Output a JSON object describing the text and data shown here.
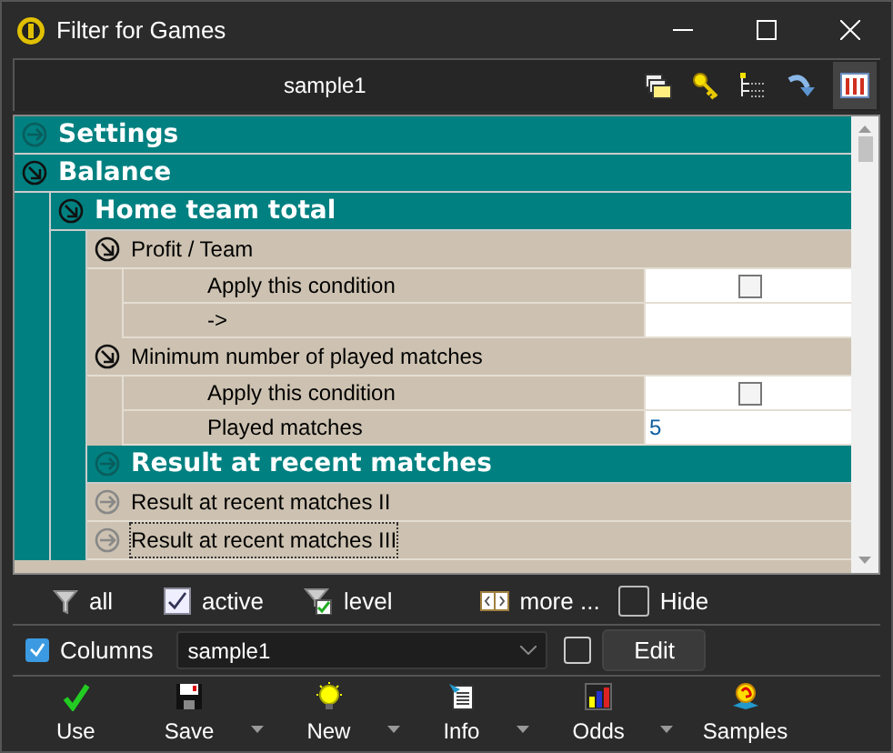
{
  "window": {
    "title": "Filter for Games"
  },
  "toolbar": {
    "filter_name": "sample1"
  },
  "tree": [
    {
      "kind": "category",
      "label": "Settings",
      "expanded": false
    },
    {
      "kind": "category",
      "label": "Balance",
      "expanded": true,
      "children": [
        {
          "kind": "category",
          "label": "Home team total",
          "expanded": true,
          "children": [
            {
              "kind": "group",
              "label": "Profit / Team",
              "expanded": true,
              "children": [
                {
                  "kind": "check",
                  "label": "Apply this condition",
                  "checked": false
                },
                {
                  "kind": "text",
                  "label": "->"
                }
              ]
            },
            {
              "kind": "group",
              "label": "Minimum number of played matches",
              "expanded": true,
              "children": [
                {
                  "kind": "check",
                  "label": "Apply this condition",
                  "checked": false
                },
                {
                  "kind": "text",
                  "label": "Played matches",
                  "value": "5"
                }
              ]
            },
            {
              "kind": "category",
              "label": "Result at recent matches",
              "expanded": false
            },
            {
              "kind": "group",
              "label": "Result at recent matches II",
              "expanded": false,
              "focused": false
            },
            {
              "kind": "group",
              "label": "Result at recent matches III",
              "expanded": false,
              "focused": true
            }
          ]
        }
      ]
    }
  ],
  "filter_bar": [
    {
      "kind": "funnel",
      "label": "all"
    },
    {
      "kind": "check",
      "label": "active",
      "checked": true
    },
    {
      "kind": "funnel-check",
      "label": "level"
    },
    {
      "kind": "more",
      "label": "more ..."
    },
    {
      "kind": "check",
      "label": "Hide",
      "checked": false
    }
  ],
  "columns_bar": {
    "label": "Columns",
    "checked": true,
    "combo_value": "sample1",
    "extra_checked": false,
    "button": "Edit"
  },
  "actions": [
    {
      "kind": "use",
      "label": "Use",
      "menu": false
    },
    {
      "kind": "save",
      "label": "Save",
      "menu": true
    },
    {
      "kind": "new",
      "label": "New",
      "menu": true
    },
    {
      "kind": "info",
      "label": "Info",
      "menu": true
    },
    {
      "kind": "odds",
      "label": "Odds",
      "menu": true
    },
    {
      "kind": "samples",
      "label": "Samples",
      "menu": false
    }
  ]
}
